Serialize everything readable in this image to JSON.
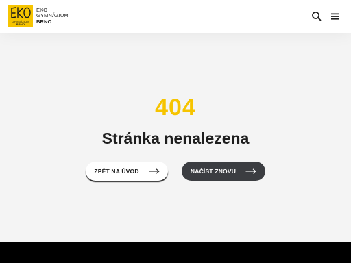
{
  "header": {
    "logo": {
      "mark": "EKO",
      "mark_small_line1": "GYMNÁZIUM",
      "mark_small_line2": "BRNO",
      "line1": "EKO",
      "line2": "GYMNÁZIUM",
      "line3": "BRNO"
    },
    "search_icon": "search-icon",
    "menu_icon": "hamburger-menu-icon"
  },
  "error": {
    "code": "404",
    "title": "Stránka nenalezena"
  },
  "actions": {
    "home_label": "ZPĚT NA ÚVOD",
    "reload_label": "NAČÍST ZNOVU",
    "arrow_icon": "arrow-right-icon"
  },
  "colors": {
    "accent": "#f6c400",
    "dark_button": "#3b3d41",
    "footer": "#000000"
  }
}
